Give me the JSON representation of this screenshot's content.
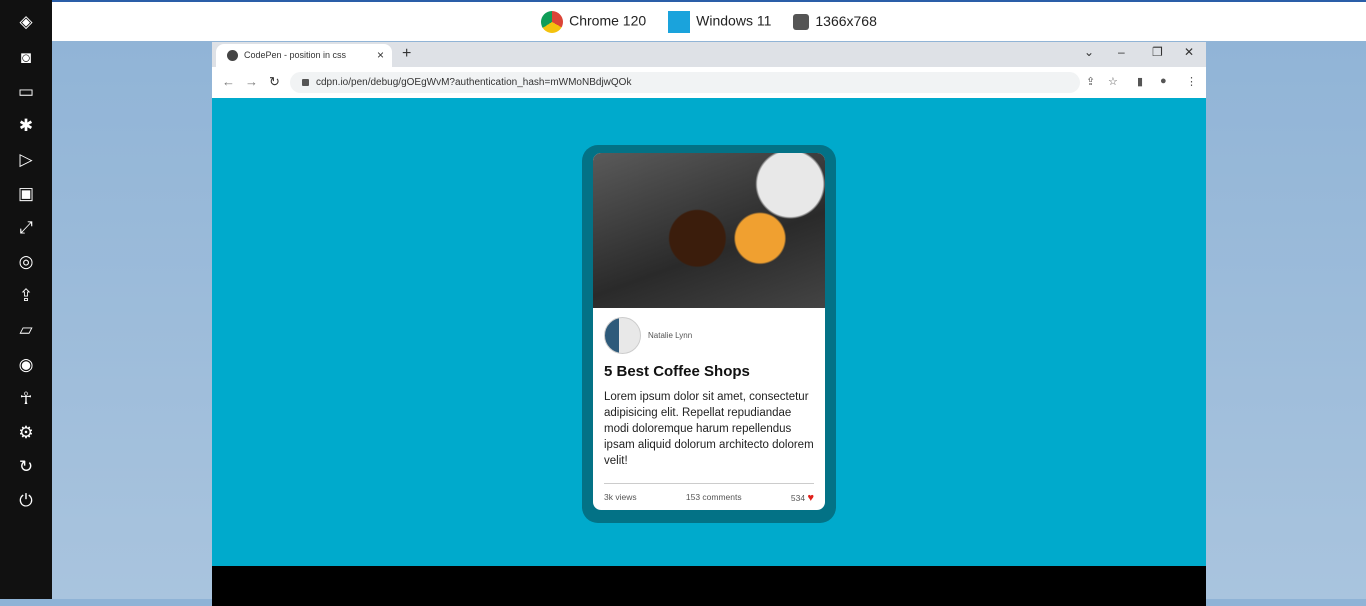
{
  "sidebar": {
    "icons": [
      "logo-icon",
      "camera-icon",
      "video-icon",
      "bug-icon",
      "play-icon",
      "monitor-icon",
      "resize-icon",
      "globe-icon",
      "upload-icon",
      "folder-icon",
      "chrome-icon",
      "accessibility-icon",
      "settings-icon",
      "sync-icon",
      "power-icon"
    ]
  },
  "topbar": {
    "browser": "Chrome 120",
    "os": "Windows 11",
    "resolution": "1366x768"
  },
  "browser": {
    "tab_title": "CodePen - position in css",
    "url": "cdpn.io/pen/debug/gOEgWvM?authentication_hash=mWMoNBdjwQOk"
  },
  "card": {
    "author": "Natalie Lynn",
    "title": "5 Best Coffee Shops",
    "body": "Lorem ipsum dolor sit amet, consectetur adipisicing elit. Repellat repudiandae modi doloremque harum repellendus ipsam aliquid dolorum architecto dolorem velit!",
    "views": "3k views",
    "comments": "153 comments",
    "likes": "534"
  },
  "colors": {
    "page_bg": "#00aacc",
    "card_frame": "#037286",
    "heart": "#e0201a"
  }
}
